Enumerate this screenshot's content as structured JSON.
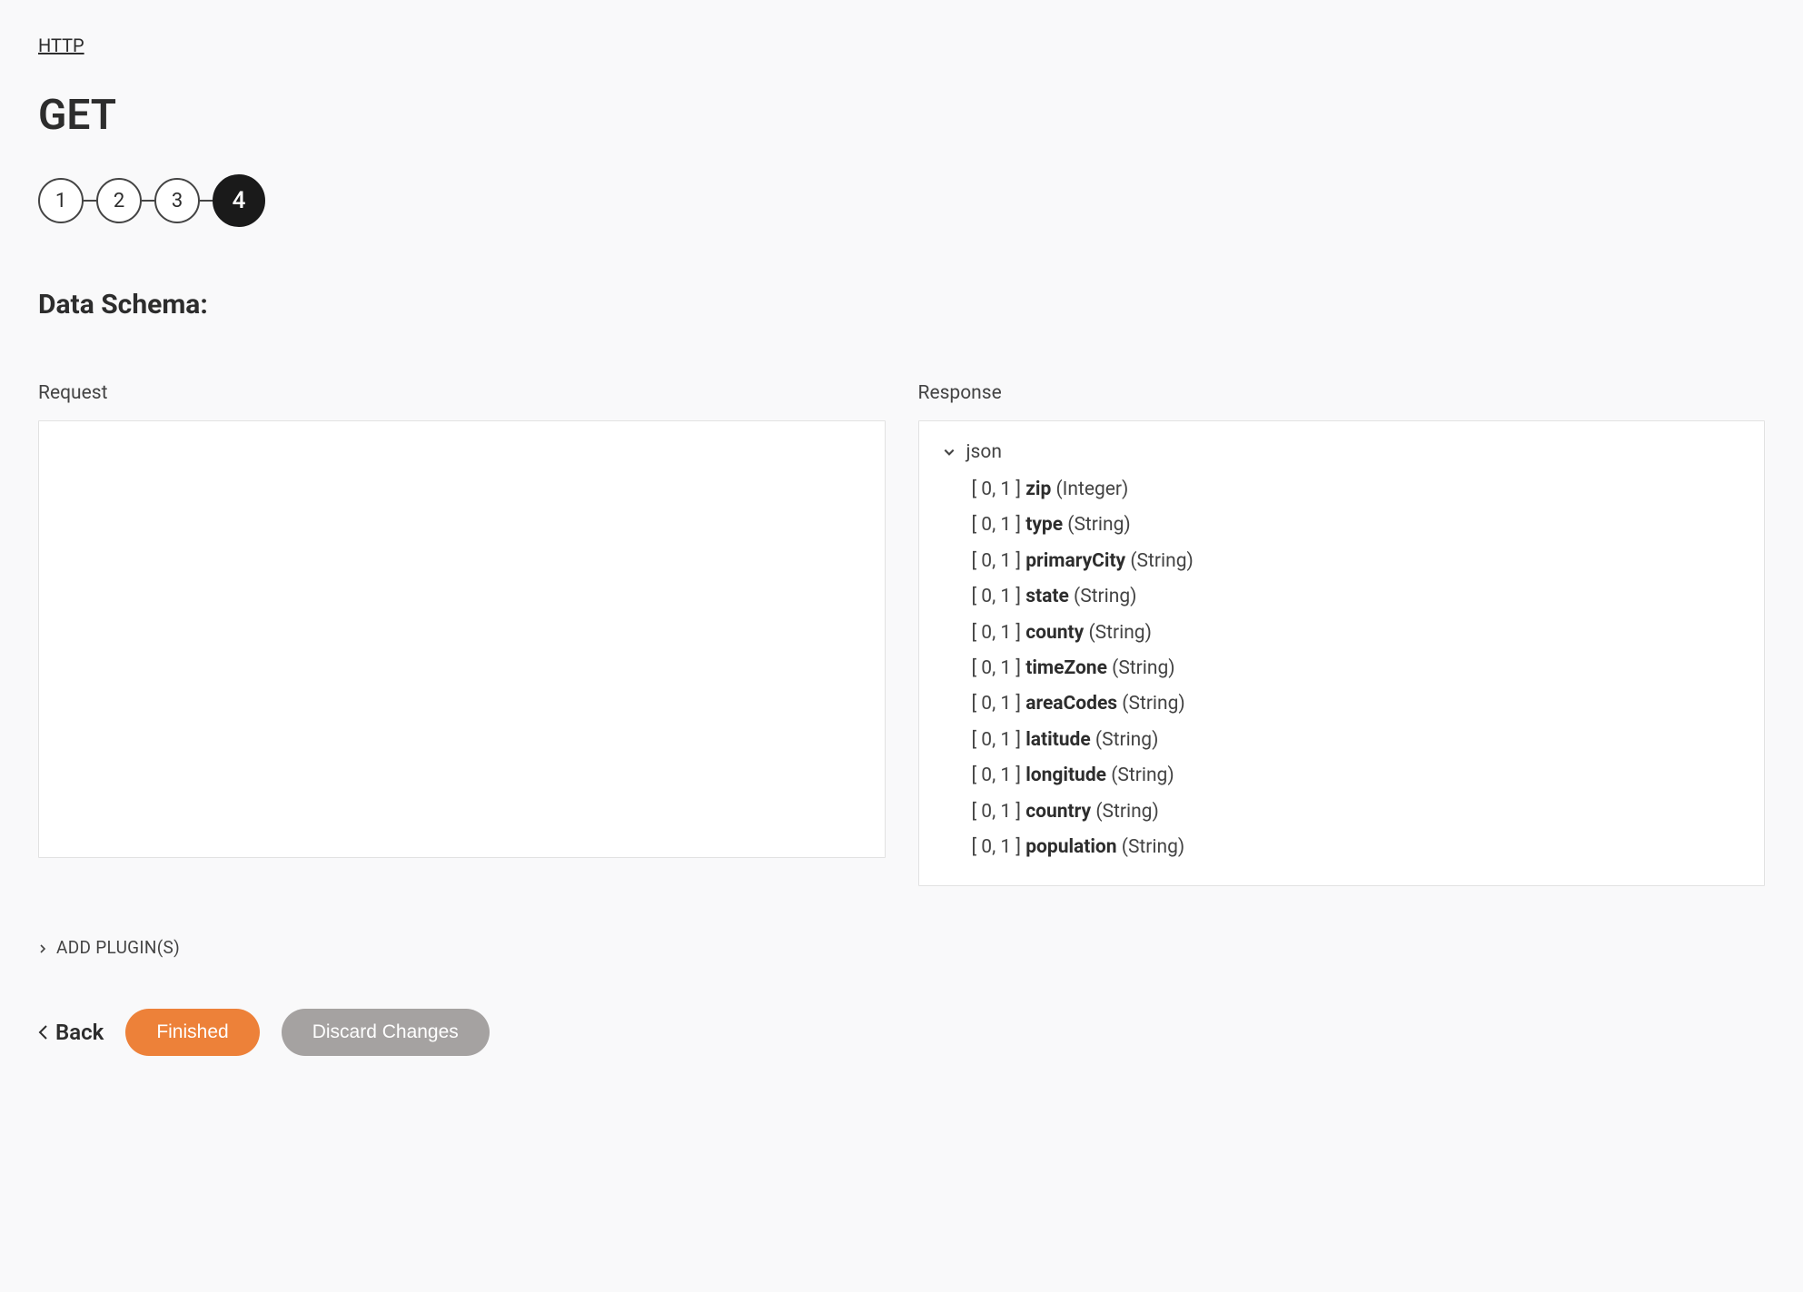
{
  "breadcrumb": "HTTP",
  "title": "GET",
  "steps": [
    "1",
    "2",
    "3",
    "4"
  ],
  "activeStepIndex": 3,
  "sectionTitle": "Data Schema:",
  "requestLabel": "Request",
  "responseLabel": "Response",
  "tree": {
    "rootLabel": "json",
    "fields": [
      {
        "prefix": "[ 0, 1 ]",
        "name": "zip",
        "type": "(Integer)"
      },
      {
        "prefix": "[ 0, 1 ]",
        "name": "type",
        "type": "(String)"
      },
      {
        "prefix": "[ 0, 1 ]",
        "name": "primaryCity",
        "type": "(String)"
      },
      {
        "prefix": "[ 0, 1 ]",
        "name": "state",
        "type": "(String)"
      },
      {
        "prefix": "[ 0, 1 ]",
        "name": "county",
        "type": "(String)"
      },
      {
        "prefix": "[ 0, 1 ]",
        "name": "timeZone",
        "type": "(String)"
      },
      {
        "prefix": "[ 0, 1 ]",
        "name": "areaCodes",
        "type": "(String)"
      },
      {
        "prefix": "[ 0, 1 ]",
        "name": "latitude",
        "type": "(String)"
      },
      {
        "prefix": "[ 0, 1 ]",
        "name": "longitude",
        "type": "(String)"
      },
      {
        "prefix": "[ 0, 1 ]",
        "name": "country",
        "type": "(String)"
      },
      {
        "prefix": "[ 0, 1 ]",
        "name": "population",
        "type": "(String)"
      }
    ]
  },
  "addPluginsLabel": "ADD PLUGIN(S)",
  "backLabel": "Back",
  "finishedLabel": "Finished",
  "discardLabel": "Discard Changes"
}
